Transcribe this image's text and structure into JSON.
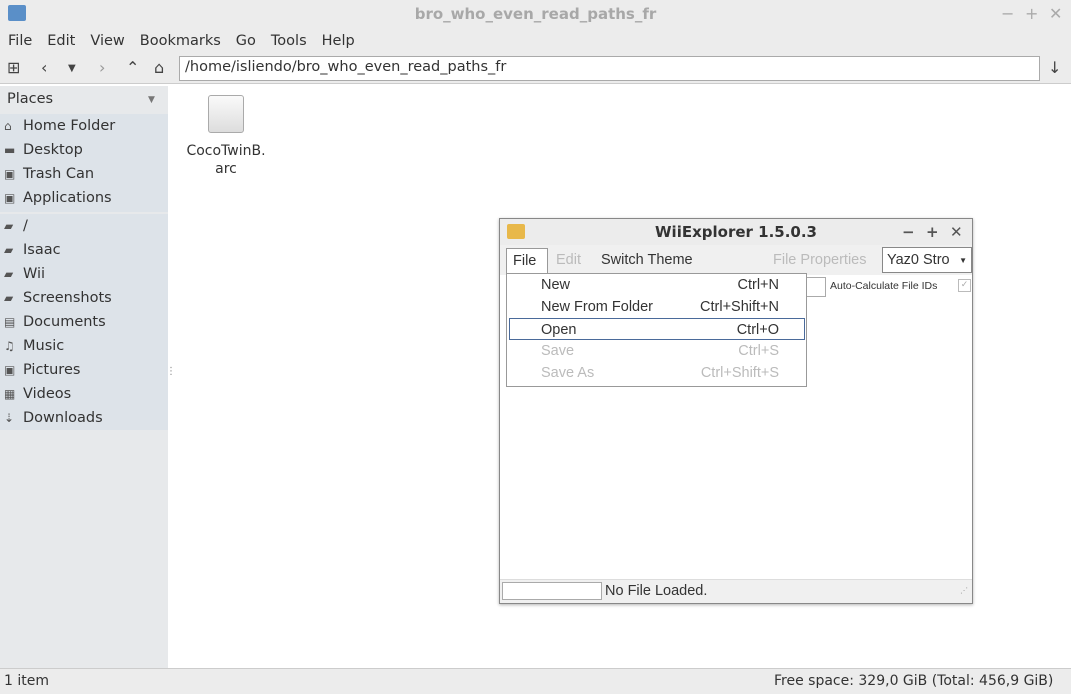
{
  "window": {
    "title": "bro_who_even_read_paths_fr",
    "icon": "folder-icon"
  },
  "menubar": [
    "File",
    "Edit",
    "View",
    "Bookmarks",
    "Go",
    "Tools",
    "Help"
  ],
  "toolbar": {
    "path": "/home/isliendo/bro_who_even_read_paths_fr"
  },
  "sidebar": {
    "header": "Places",
    "places": [
      {
        "label": "Home Folder",
        "icon": "home-icon"
      },
      {
        "label": "Desktop",
        "icon": "desktop-icon"
      },
      {
        "label": "Trash Can",
        "icon": "trash-icon"
      },
      {
        "label": "Applications",
        "icon": "applications-icon"
      }
    ],
    "devices": [
      {
        "label": "/",
        "icon": "folder-icon"
      },
      {
        "label": "Isaac",
        "icon": "folder-icon"
      },
      {
        "label": "Wii",
        "icon": "folder-icon"
      },
      {
        "label": "Screenshots",
        "icon": "folder-icon"
      },
      {
        "label": "Documents",
        "icon": "documents-icon"
      },
      {
        "label": "Music",
        "icon": "music-icon"
      },
      {
        "label": "Pictures",
        "icon": "pictures-icon"
      },
      {
        "label": "Videos",
        "icon": "videos-icon"
      },
      {
        "label": "Downloads",
        "icon": "downloads-icon"
      }
    ]
  },
  "files": [
    {
      "name_line1": "CocoTwinB.",
      "name_line2": "arc"
    }
  ],
  "status": {
    "items": "1 item",
    "free": "Free space: 329,0 GiB (Total: 456,9 GiB)"
  },
  "wii": {
    "title": "WiiExplorer 1.5.0.3",
    "menus": [
      "File",
      "Edit",
      "Switch Theme",
      "File Properties"
    ],
    "compression": "Yaz0 Stro",
    "auto_calc": "Auto-Calculate File IDs",
    "file_menu": [
      {
        "label": "New",
        "shortcut": "Ctrl+N",
        "enabled": true
      },
      {
        "label": "New From Folder",
        "shortcut": "Ctrl+Shift+N",
        "enabled": true
      },
      {
        "label": "Open",
        "shortcut": "Ctrl+O",
        "enabled": true,
        "highlighted": true
      },
      {
        "label": "Save",
        "shortcut": "Ctrl+S",
        "enabled": false
      },
      {
        "label": "Save As",
        "shortcut": "Ctrl+Shift+S",
        "enabled": false
      }
    ],
    "status": "No File Loaded."
  }
}
